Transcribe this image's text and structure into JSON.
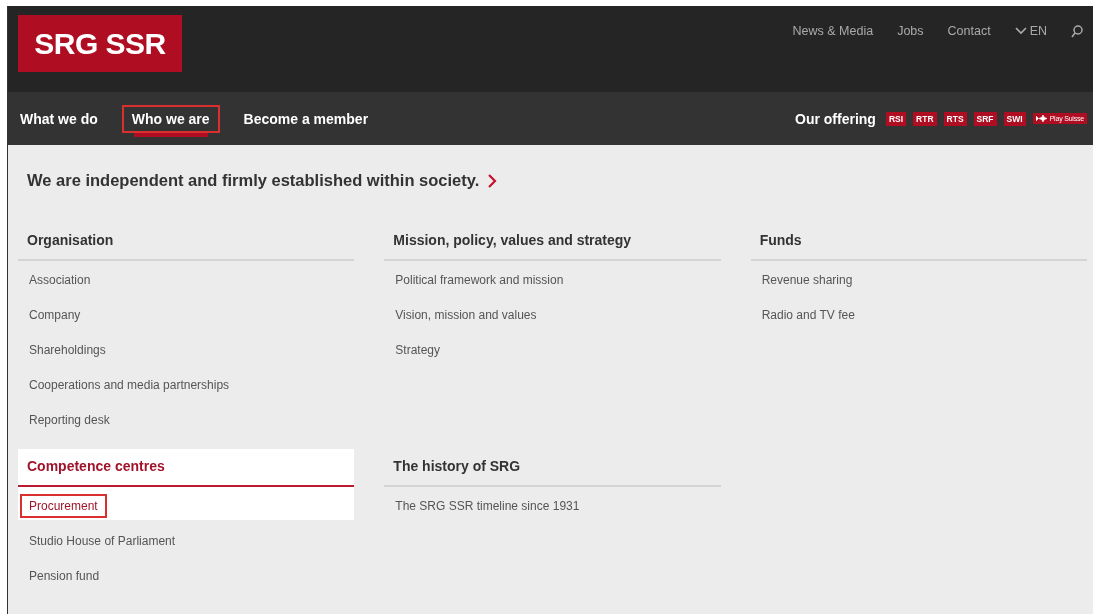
{
  "logo": {
    "text": "SRG SSR"
  },
  "top_links": [
    {
      "label": "News & Media"
    },
    {
      "label": "Jobs"
    },
    {
      "label": "Contact"
    }
  ],
  "language": {
    "label": "EN"
  },
  "nav": [
    {
      "label": "What we do",
      "selected": false,
      "highlighted": false
    },
    {
      "label": "Who we are",
      "selected": true,
      "highlighted": true
    },
    {
      "label": "Become a member",
      "selected": false,
      "highlighted": false
    }
  ],
  "offering": {
    "label": "Our offering",
    "badges": [
      {
        "label": "RSI",
        "kind": "text"
      },
      {
        "label": "RTR",
        "kind": "text"
      },
      {
        "label": "RTS",
        "kind": "text"
      },
      {
        "label": "SRF",
        "kind": "text"
      },
      {
        "label": "SWI",
        "kind": "text"
      },
      {
        "label": "Play Suisse",
        "kind": "play"
      }
    ]
  },
  "headline": "We are independent and firmly established within society.",
  "sections": [
    {
      "title": "Organisation",
      "active": false,
      "items": [
        {
          "label": "Association",
          "highlighted": false
        },
        {
          "label": "Company",
          "highlighted": false
        },
        {
          "label": "Shareholdings",
          "highlighted": false
        },
        {
          "label": "Cooperations and media partnerships",
          "highlighted": false
        },
        {
          "label": "Reporting desk",
          "highlighted": false
        }
      ]
    },
    {
      "title": "Mission, policy, values and strategy",
      "active": false,
      "items": [
        {
          "label": "Political framework and mission",
          "highlighted": false
        },
        {
          "label": "Vision, mission and values",
          "highlighted": false
        },
        {
          "label": "Strategy",
          "highlighted": false
        }
      ]
    },
    {
      "title": "Funds",
      "active": false,
      "items": [
        {
          "label": "Revenue sharing",
          "highlighted": false
        },
        {
          "label": "Radio and TV fee",
          "highlighted": false
        }
      ]
    },
    {
      "title": "Competence centres",
      "active": true,
      "items": [
        {
          "label": "Procurement",
          "highlighted": true
        },
        {
          "label": "Studio House of Parliament",
          "highlighted": false
        },
        {
          "label": "Pension fund",
          "highlighted": false
        }
      ]
    },
    {
      "title": "The history of SRG",
      "active": false,
      "items": [
        {
          "label": "The SRG SSR timeline since 1931",
          "highlighted": false
        }
      ]
    }
  ]
}
